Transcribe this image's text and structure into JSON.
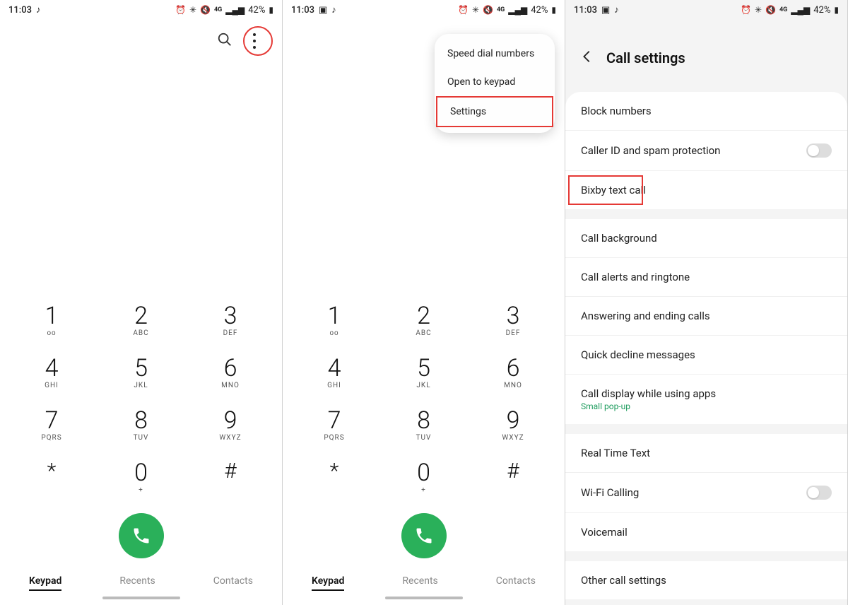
{
  "statusbar": {
    "time": "11:03",
    "network_label": "4G",
    "battery_pct": "42%"
  },
  "dialer": {
    "keys": [
      [
        {
          "d": "1",
          "l": "ᴏᴏ"
        },
        {
          "d": "2",
          "l": "ABC"
        },
        {
          "d": "3",
          "l": "DEF"
        }
      ],
      [
        {
          "d": "4",
          "l": "GHI"
        },
        {
          "d": "5",
          "l": "JKL"
        },
        {
          "d": "6",
          "l": "MNO"
        }
      ],
      [
        {
          "d": "7",
          "l": "PQRS"
        },
        {
          "d": "8",
          "l": "TUV"
        },
        {
          "d": "9",
          "l": "WXYZ"
        }
      ],
      [
        {
          "d": "*",
          "l": ""
        },
        {
          "d": "0",
          "l": "+"
        },
        {
          "d": "#",
          "l": ""
        }
      ]
    ],
    "tabs": [
      "Keypad",
      "Recents",
      "Contacts"
    ],
    "active_tab": 0
  },
  "popup_menu": {
    "items": [
      "Speed dial numbers",
      "Open to keypad",
      "Settings"
    ],
    "highlight_index": 2
  },
  "settings": {
    "title": "Call settings",
    "group1": [
      {
        "label": "Block numbers",
        "toggle": false
      },
      {
        "label": "Caller ID and spam protection",
        "toggle": true,
        "toggle_on": false
      },
      {
        "label": "Bixby text call",
        "toggle": false,
        "highlight": true
      }
    ],
    "group2": [
      {
        "label": "Call background"
      },
      {
        "label": "Call alerts and ringtone"
      },
      {
        "label": "Answering and ending calls"
      },
      {
        "label": "Quick decline messages"
      },
      {
        "label": "Call display while using apps",
        "sub": "Small pop-up"
      }
    ],
    "group3": [
      {
        "label": "Real Time Text"
      },
      {
        "label": "Wi-Fi Calling",
        "toggle": true,
        "toggle_on": false
      },
      {
        "label": "Voicemail"
      }
    ],
    "group4": [
      {
        "label": "Other call settings"
      }
    ]
  }
}
